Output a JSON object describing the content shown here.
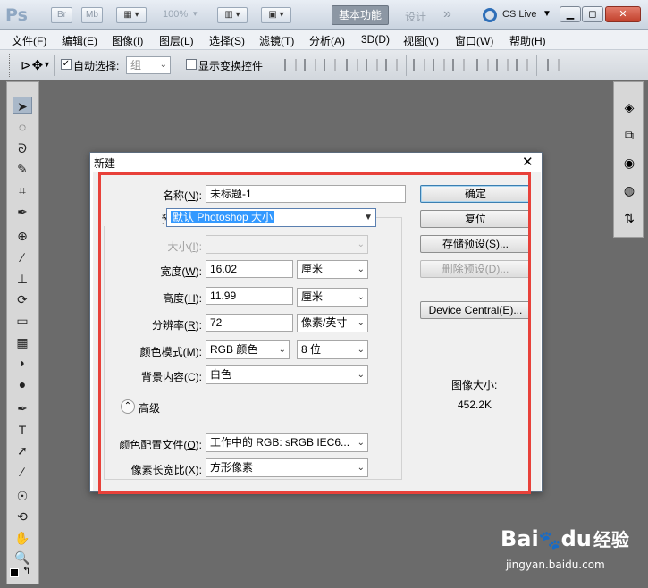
{
  "app": {
    "logo": "Ps",
    "bridge": "Br",
    "minibridge": "Mb",
    "zoom": "100%",
    "workspace_active": "基本功能",
    "workspace_design": "设计",
    "more": "»",
    "cs_live": "CS Live",
    "window_controls": {
      "minimize": "▁",
      "restore": "◻",
      "close": "✕"
    }
  },
  "menu": [
    "文件(F)",
    "编辑(E)",
    "图像(I)",
    "图层(L)",
    "选择(S)",
    "滤镜(T)",
    "分析(A)",
    "3D(D)",
    "视图(V)",
    "窗口(W)",
    "帮助(H)"
  ],
  "options": {
    "auto_select_label": "自动选择:",
    "auto_select_checked": true,
    "auto_select_value": "组",
    "show_transform_label": "显示变换控件",
    "show_transform_checked": false
  },
  "tools": [
    "move-tool",
    "marquee-tool",
    "lasso-tool",
    "quick-select-tool",
    "crop-tool",
    "eyedropper-tool",
    "healing-brush-tool",
    "brush-tool",
    "clone-stamp-tool",
    "history-brush-tool",
    "eraser-tool",
    "gradient-tool",
    "blur-tool",
    "dodge-tool",
    "pen-tool",
    "type-tool",
    "path-select-tool",
    "line-tool",
    "3d-rotate-tool",
    "3d-orbit-tool",
    "hand-tool",
    "zoom-tool"
  ],
  "tool_glyphs": [
    "➤",
    "◌",
    "ᘐ",
    "✎",
    "⌗",
    "✒",
    "⊕",
    "∕",
    "⊥",
    "⟳",
    "▭",
    "▦",
    "◗",
    "●",
    "✒",
    "T",
    "➚",
    "∕",
    "☉",
    "⟲",
    "✋",
    "🔍"
  ],
  "right_panel_glyphs": [
    "◈",
    "⧉",
    "◉",
    "◍",
    "⇅"
  ],
  "dialog": {
    "title": "新建",
    "close": "✕",
    "name": {
      "label": "名称(",
      "key": "N",
      "suffix": "):",
      "value": "未标题-1"
    },
    "preset": {
      "label": "预设(",
      "key": "P",
      "suffix": "):",
      "value": "默认 Photoshop 大小"
    },
    "size": {
      "label": "大小(",
      "key": "I",
      "suffix": "):",
      "value": ""
    },
    "width": {
      "label": "宽度(",
      "key": "W",
      "suffix": "):",
      "value": "16.02",
      "unit": "厘米"
    },
    "height": {
      "label": "高度(",
      "key": "H",
      "suffix": "):",
      "value": "11.99",
      "unit": "厘米"
    },
    "resolution": {
      "label": "分辨率(",
      "key": "R",
      "suffix": "):",
      "value": "72",
      "unit": "像素/英寸"
    },
    "color_mode": {
      "label": "颜色模式(",
      "key": "M",
      "suffix": "):",
      "value": "RGB 颜色",
      "depth": "8 位"
    },
    "background": {
      "label": "背景内容(",
      "key": "C",
      "suffix": "):",
      "value": "白色"
    },
    "advanced": "高级",
    "color_profile": {
      "label": "颜色配置文件(",
      "key": "O",
      "suffix": "):",
      "value": "工作中的 RGB: sRGB IEC6..."
    },
    "pixel_aspect": {
      "label": "像素长宽比(",
      "key": "X",
      "suffix": "):",
      "value": "方形像素"
    },
    "buttons": {
      "ok": "确定",
      "reset": "复位",
      "save_preset": "存储预设(S)...",
      "delete_preset": "删除预设(D)...",
      "device_central": "Device Central(E)..."
    },
    "image_size_label": "图像大小:",
    "image_size_value": "452.2K"
  },
  "watermark": {
    "brand": "Bai",
    "brand2": "du",
    "cn": "经验",
    "url": "jingyan.baidu.com"
  },
  "colors": {
    "highlight_box": "#e8413a",
    "selection": "#3399ff",
    "workspace_bg": "#6b6b6b"
  }
}
